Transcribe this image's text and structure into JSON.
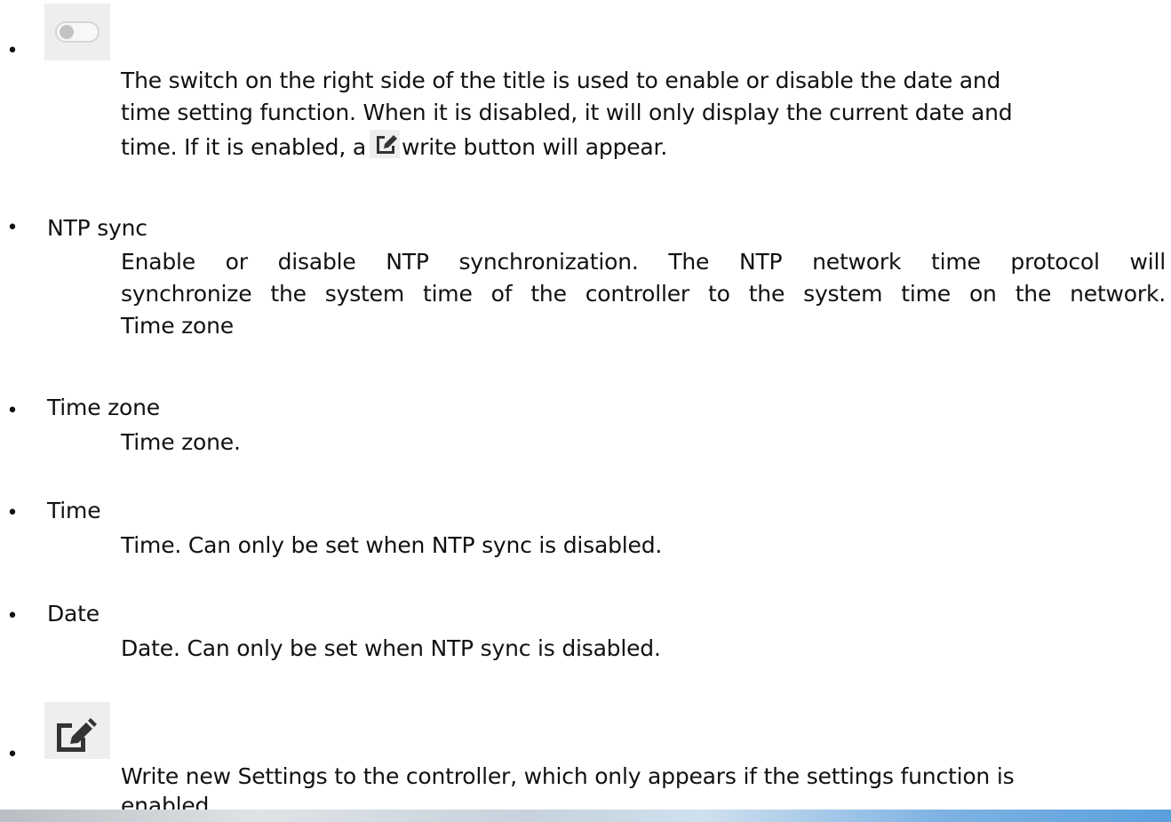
{
  "items": [
    {
      "icon": "toggle-switch-icon",
      "desc_lines": [
        "The switch on the right side of the title is used to enable or disable the date and",
        "time setting function. When it is disabled, it will only display the current date and"
      ],
      "desc_last_before": "time. If it is enabled, a",
      "desc_inline_icon": "edit-icon",
      "desc_last_after": "write button will appear."
    },
    {
      "term": "NTP sync",
      "desc_lines": [
        "Enable or disable NTP synchronization. The NTP network time protocol will",
        "synchronize the system time of the controller to the system time on the network.",
        "Time zone"
      ]
    },
    {
      "term": "Time zone",
      "desc": "Time zone."
    },
    {
      "term": "Time",
      "desc": "Time. Can only be set when NTP sync is disabled."
    },
    {
      "term": "Date",
      "desc": "Date. Can only be set when NTP sync is disabled."
    },
    {
      "icon": "edit-icon",
      "desc_lines": [
        "Write new Settings to the controller, which only appears if the settings function is",
        "enabled."
      ]
    }
  ],
  "bullet_char": "•",
  "colors": {
    "text": "#111111",
    "icon_tile_bg": "#eeeeee",
    "toggle_knob": "#c3c3c3",
    "edit_icon": "#333333"
  }
}
